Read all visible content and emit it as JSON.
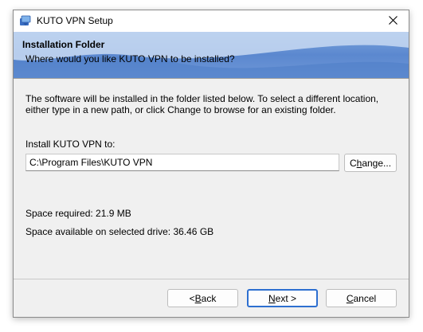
{
  "window": {
    "title": "KUTO VPN Setup"
  },
  "banner": {
    "title": "Installation Folder",
    "subtitle": "Where would you like KUTO VPN to be installed?"
  },
  "content": {
    "description": "The software will be installed in the folder listed below. To select a different location, either type in a new path, or click Change to browse for an existing folder.",
    "install_label": "Install KUTO VPN to:",
    "install_path": "C:\\Program Files\\KUTO VPN",
    "space_required": "Space required: 21.9 MB",
    "space_available": "Space available on selected drive: 36.46 GB"
  },
  "buttons": {
    "change_pre": "C",
    "change_u": "h",
    "change_post": "ange...",
    "back_pre": "< ",
    "back_u": "B",
    "back_post": "ack",
    "next_u": "N",
    "next_post": "ext >",
    "cancel_u": "C",
    "cancel_post": "ancel"
  },
  "icons": {
    "app": "installer-icon",
    "close": "close-icon"
  },
  "colors": {
    "banner": "#5b88cf",
    "default_button_border": "#2d6fd0"
  }
}
